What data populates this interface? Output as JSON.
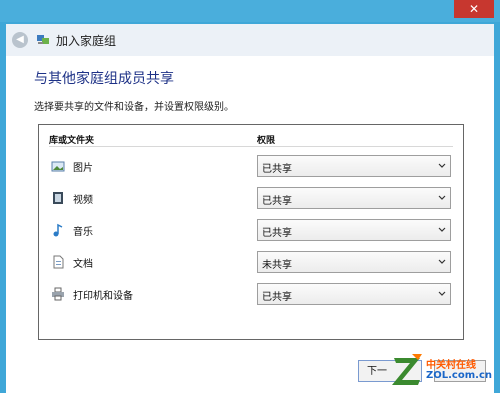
{
  "window": {
    "close_glyph": "✕",
    "title": "加入家庭组"
  },
  "page": {
    "heading": "与其他家庭组成员共享",
    "description": "选择要共享的文件和设备，并设置权限级别。"
  },
  "table": {
    "col_library": "库或文件夹",
    "col_permission": "权限",
    "rows": [
      {
        "icon": "pictures-icon",
        "label": "图片",
        "permission": "已共享"
      },
      {
        "icon": "videos-icon",
        "label": "视频",
        "permission": "已共享"
      },
      {
        "icon": "music-icon",
        "label": "音乐",
        "permission": "已共享"
      },
      {
        "icon": "documents-icon",
        "label": "文档",
        "permission": "未共享"
      },
      {
        "icon": "printer-icon",
        "label": "打印机和设备",
        "permission": "已共享"
      }
    ]
  },
  "buttons": {
    "next": "下一"
  },
  "watermark": {
    "name": "中关村在线",
    "site": "ZOL.com.cn"
  }
}
